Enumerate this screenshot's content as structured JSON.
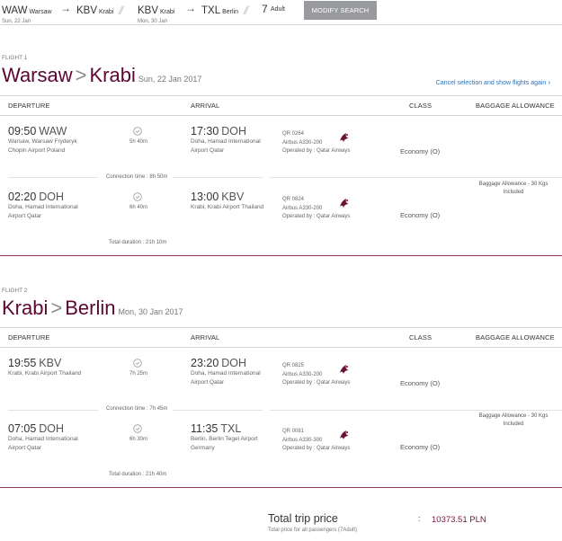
{
  "search": {
    "leg1": {
      "from_code": "WAW",
      "from_city": "Warsaw",
      "date": "Sun, 22 Jan",
      "to_code": "KBV",
      "to_city": "Krabi"
    },
    "leg2": {
      "from_code": "KBV",
      "from_city": "Krabi",
      "date": "Mon, 30 Jan",
      "to_code": "TXL",
      "to_city": "Berlin"
    },
    "passengers": "7",
    "passengers_label": "Adult",
    "modify_label": "MODIFY SEARCH",
    "arrow_glyph": "→",
    "separator_glyph": "//"
  },
  "columns": {
    "departure": "DEPARTURE",
    "arrival": "ARRIVAL",
    "class": "CLASS",
    "baggage": "BAGGAGE ALLOWANCE"
  },
  "flight1": {
    "label": "FLIGHT 1",
    "from_city": "Warsaw",
    "to_city": "Krabi",
    "date": "Sun, 22 Jan 2017",
    "cancel_link": "Cancel selection and show flights again",
    "segments": [
      {
        "dep_time": "09:50",
        "dep_code": "WAW",
        "dep_place": "Warsaw, Warsaw Fryderyk Chopin Airport Poland",
        "duration": "5h 40m",
        "arr_time": "17:30",
        "arr_code": "DOH",
        "arr_place": "Doha, Hamad International Airport Qatar",
        "flight_no": "QR 0264",
        "aircraft": "Airbus A330-200",
        "operator": "Operated by : Qatar Airways",
        "cabin": "Economy (O)"
      },
      {
        "dep_time": "02:20",
        "dep_code": "DOH",
        "dep_place": "Doha, Hamad International Airport Qatar",
        "duration": "6h 40m",
        "arr_time": "13:00",
        "arr_code": "KBV",
        "arr_place": "Krabi, Krabi Airport Thailand",
        "flight_no": "QR 0824",
        "aircraft": "Airbus A330-200",
        "operator": "Operated by : Qatar Airways",
        "cabin": "Economy (O)"
      }
    ],
    "connection": "Connection time : 8h 50m",
    "total_duration": "Total duration : 21h 10m",
    "baggage": "Baggage Allowance - 30 Kgs Included"
  },
  "flight2": {
    "label": "FLIGHT 2",
    "from_city": "Krabi",
    "to_city": "Berlin",
    "date": "Mon, 30 Jan 2017",
    "segments": [
      {
        "dep_time": "19:55",
        "dep_code": "KBV",
        "dep_place": "Krabi, Krabi Airport Thailand",
        "duration": "7h 25m",
        "arr_time": "23:20",
        "arr_code": "DOH",
        "arr_place": "Doha, Hamad International Airport Qatar",
        "flight_no": "QR 0825",
        "aircraft": "Airbus A330-200",
        "operator": "Operated by : Qatar Airways",
        "cabin": "Economy (O)"
      },
      {
        "dep_time": "07:05",
        "dep_code": "DOH",
        "dep_place": "Doha, Hamad International Airport Qatar",
        "duration": "6h 30m",
        "arr_time": "11:35",
        "arr_code": "TXL",
        "arr_place": "Berlin, Berlin Tegel Airport Germany",
        "flight_no": "QR 0081",
        "aircraft": "Airbus A330-300",
        "operator": "Operated by : Qatar Airways",
        "cabin": "Economy (O)"
      }
    ],
    "connection": "Connection time : 7h 45m",
    "total_duration": "Total duration : 21h 40m",
    "baggage": "Baggage Allowance - 30 Kgs Included"
  },
  "trip": {
    "title": "Total trip price",
    "subtitle": "Total price for all passengers (7Adult)",
    "colon": ":",
    "price": "10373.51 PLN"
  },
  "icons": {
    "heading_arrow": ">",
    "cancel_chevron": "›"
  },
  "colors": {
    "brand": "#5c0632",
    "accent_line": "#8d3a58",
    "price": "#7a1140",
    "link": "#2a72b8",
    "button": "#999a9d"
  }
}
